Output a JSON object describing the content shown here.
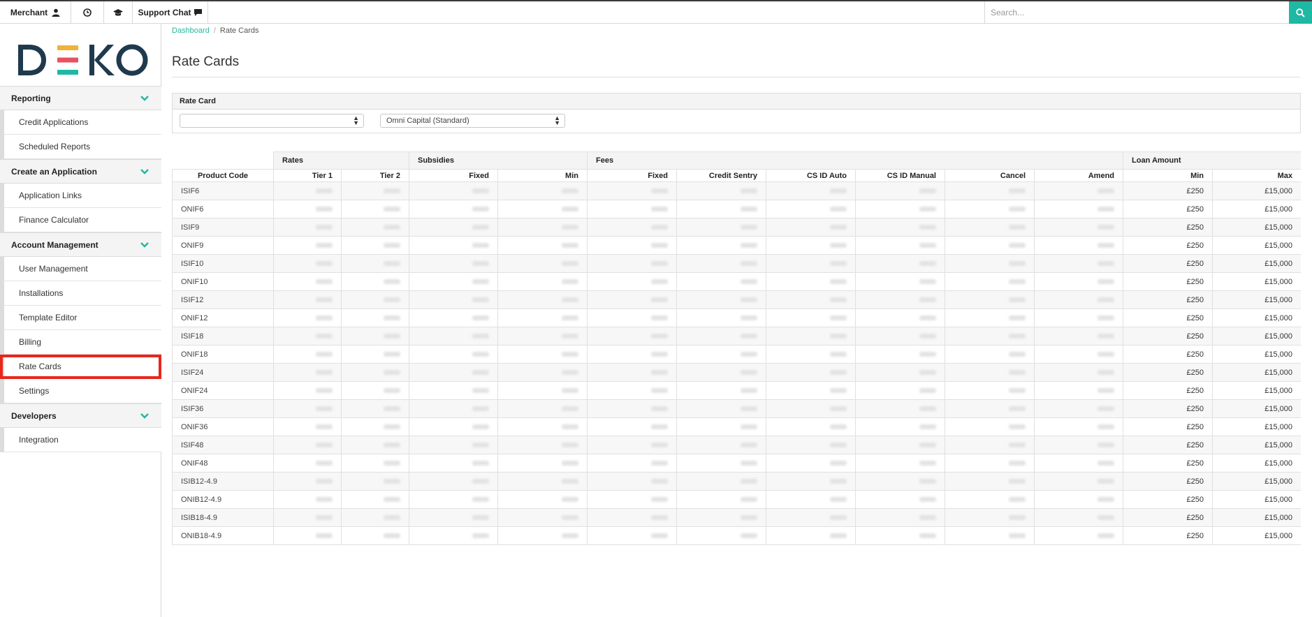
{
  "topbar": {
    "merchant_label": "Merchant",
    "support_label": "Support Chat",
    "search_placeholder": "Search..."
  },
  "colors": {
    "accent": "#1fb8a4",
    "highlight": "#e8261b"
  },
  "logo": {
    "text": "DEKO"
  },
  "sidebar": {
    "sections": [
      {
        "title": "Reporting",
        "items": [
          "Credit Applications",
          "Scheduled Reports"
        ]
      },
      {
        "title": "Create an Application",
        "items": [
          "Application Links",
          "Finance Calculator"
        ]
      },
      {
        "title": "Account Management",
        "items": [
          "User Management",
          "Installations",
          "Template Editor",
          "Billing",
          "Rate Cards",
          "Settings"
        ]
      },
      {
        "title": "Developers",
        "items": [
          "Integration"
        ]
      }
    ],
    "active_item": "Rate Cards"
  },
  "breadcrumb": {
    "home": "Dashboard",
    "current": "Rate Cards"
  },
  "page_title": "Rate Cards",
  "rate_card": {
    "header": "Rate Card",
    "select1_value": "",
    "select2_value": "Omni Capital (Standard)"
  },
  "table": {
    "groups": [
      "Rates",
      "Subsidies",
      "Fees",
      "Loan Amount"
    ],
    "columns": [
      "Product Code",
      "Tier 1",
      "Tier 2",
      "Fixed",
      "Min",
      "Fixed",
      "Credit Sentry",
      "CS ID Auto",
      "CS ID Manual",
      "Cancel",
      "Amend",
      "Min",
      "Max"
    ],
    "rows": [
      {
        "code": "ISIF6",
        "min": "£250",
        "max": "£15,000"
      },
      {
        "code": "ONIF6",
        "min": "£250",
        "max": "£15,000"
      },
      {
        "code": "ISIF9",
        "min": "£250",
        "max": "£15,000"
      },
      {
        "code": "ONIF9",
        "min": "£250",
        "max": "£15,000"
      },
      {
        "code": "ISIF10",
        "min": "£250",
        "max": "£15,000"
      },
      {
        "code": "ONIF10",
        "min": "£250",
        "max": "£15,000"
      },
      {
        "code": "ISIF12",
        "min": "£250",
        "max": "£15,000"
      },
      {
        "code": "ONIF12",
        "min": "£250",
        "max": "£15,000"
      },
      {
        "code": "ISIF18",
        "min": "£250",
        "max": "£15,000"
      },
      {
        "code": "ONIF18",
        "min": "£250",
        "max": "£15,000"
      },
      {
        "code": "ISIF24",
        "min": "£250",
        "max": "£15,000"
      },
      {
        "code": "ONIF24",
        "min": "£250",
        "max": "£15,000"
      },
      {
        "code": "ISIF36",
        "min": "£250",
        "max": "£15,000"
      },
      {
        "code": "ONIF36",
        "min": "£250",
        "max": "£15,000"
      },
      {
        "code": "ISIF48",
        "min": "£250",
        "max": "£15,000"
      },
      {
        "code": "ONIF48",
        "min": "£250",
        "max": "£15,000"
      },
      {
        "code": "ISIB12-4.9",
        "min": "£250",
        "max": "£15,000"
      },
      {
        "code": "ONIB12-4.9",
        "min": "£250",
        "max": "£15,000"
      },
      {
        "code": "ISIB18-4.9",
        "min": "£250",
        "max": "£15,000"
      },
      {
        "code": "ONIB18-4.9",
        "min": "£250",
        "max": "£15,000"
      }
    ]
  }
}
